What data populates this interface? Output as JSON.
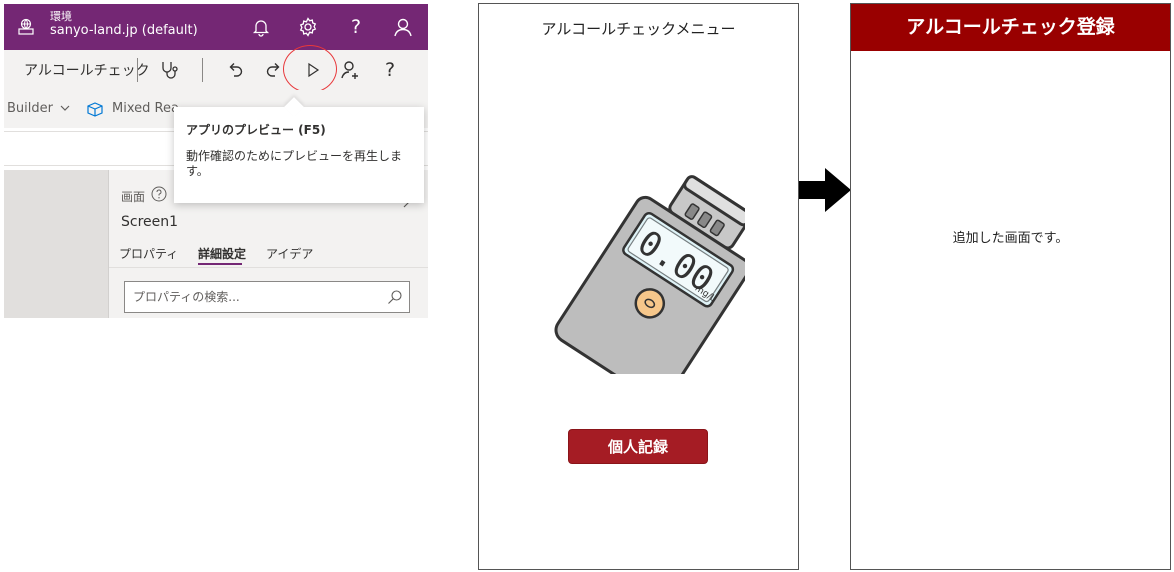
{
  "editor": {
    "topbar": {
      "environment_label": "環境",
      "environment_name": "sanyo-land.jp (default)",
      "icons": [
        "environment-icon",
        "bell-icon",
        "gear-icon",
        "help-icon",
        "user-icon"
      ],
      "help_glyph": "?",
      "bg_color": "#742774"
    },
    "commandbar": {
      "app_name": "アルコールチェック",
      "icons": [
        "stethoscope-icon",
        "undo-icon",
        "redo-icon",
        "play-preview-icon",
        "add-user-icon",
        "help-icon"
      ],
      "help_glyph": "?"
    },
    "ribbon": {
      "builder_label": "Builder",
      "mixed_reality_label": "Mixed Rea"
    },
    "tooltip": {
      "title": "アプリのプレビュー (F5)",
      "description": "動作確認のためにプレビューを再生します。"
    },
    "properties_panel": {
      "screen_type": "画面",
      "screen_name": "Screen1",
      "tabs": [
        {
          "label": "プロパティ",
          "active": false
        },
        {
          "label": "詳細設定",
          "active": true
        },
        {
          "label": "アイデア",
          "active": false
        }
      ],
      "search_placeholder": "プロパティの検索..."
    }
  },
  "phone1": {
    "title": "アルコールチェックメニュー",
    "checker_display": "0.00",
    "checker_unit": "mg/L",
    "record_button_label": "個人記録",
    "button_color": "#a51c24"
  },
  "phone2": {
    "header": "アルコールチェック登録",
    "message": "追加した画面です。",
    "header_color": "#990000"
  }
}
